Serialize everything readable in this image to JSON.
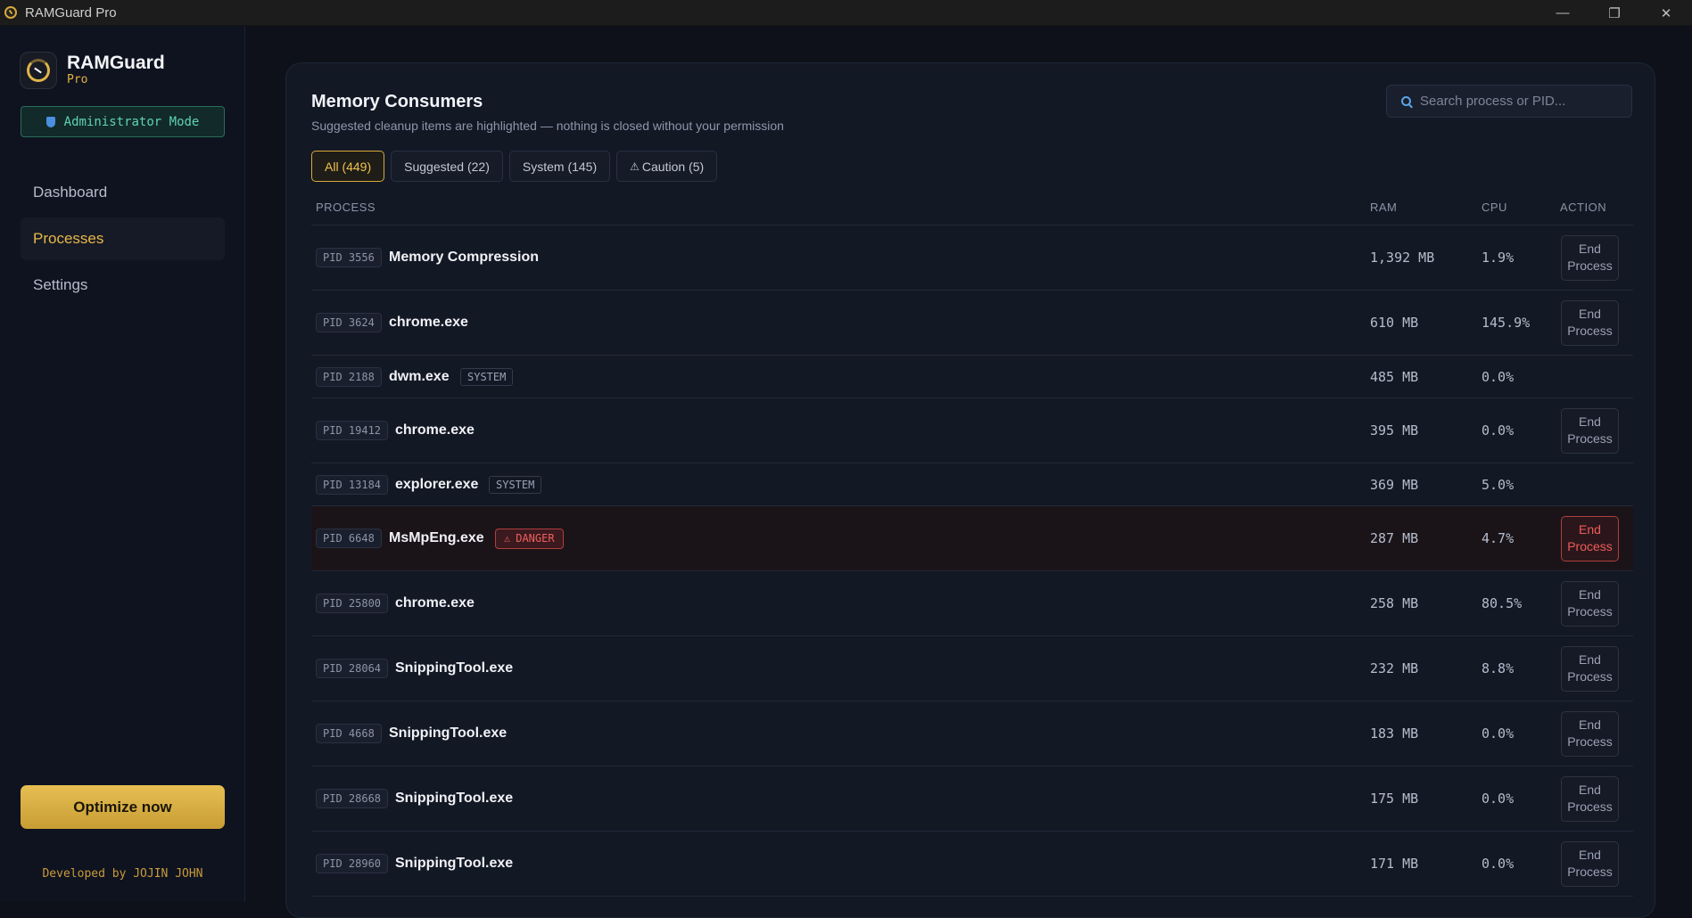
{
  "window": {
    "title": "RAMGuard Pro",
    "controls": {
      "minimize": "—",
      "maximize": "❐",
      "close": "✕"
    }
  },
  "sidebar": {
    "brand_name": "RAMGuard",
    "brand_sub": "Pro",
    "admin_badge": "Administrator Mode",
    "nav": [
      {
        "label": "Dashboard",
        "active": false
      },
      {
        "label": "Processes",
        "active": true
      },
      {
        "label": "Settings",
        "active": false
      }
    ],
    "optimize_label": "Optimize now",
    "credit": "Developed by JOJIN JOHN"
  },
  "main": {
    "title": "Memory Consumers",
    "subtitle": "Suggested cleanup items are highlighted — nothing is closed without your permission",
    "search_placeholder": "Search process or PID...",
    "filters": [
      {
        "label": "All (449)",
        "active": true
      },
      {
        "label": "Suggested (22)",
        "active": false
      },
      {
        "label": "System (145)",
        "active": false
      },
      {
        "label": "Caution (5)",
        "active": false,
        "icon": "⚠"
      }
    ],
    "columns": {
      "process": "PROCESS",
      "ram": "RAM",
      "cpu": "CPU",
      "action": "ACTION"
    },
    "end_label_line1": "End",
    "end_label_line2": "Process",
    "tag_system": "SYSTEM",
    "tag_danger": "DANGER",
    "rows": [
      {
        "pid": "PID 3556",
        "name": "Memory Compression",
        "ram": "1,392 MB",
        "cpu": "1.9%",
        "tag": "",
        "action": true
      },
      {
        "pid": "PID 3624",
        "name": "chrome.exe",
        "ram": "610 MB",
        "cpu": "145.9%",
        "tag": "",
        "action": true
      },
      {
        "pid": "PID 2188",
        "name": "dwm.exe",
        "ram": "485 MB",
        "cpu": "0.0%",
        "tag": "SYSTEM",
        "action": false
      },
      {
        "pid": "PID 19412",
        "name": "chrome.exe",
        "ram": "395 MB",
        "cpu": "0.0%",
        "tag": "",
        "action": true
      },
      {
        "pid": "PID 13184",
        "name": "explorer.exe",
        "ram": "369 MB",
        "cpu": "5.0%",
        "tag": "SYSTEM",
        "action": false
      },
      {
        "pid": "PID 6648",
        "name": "MsMpEng.exe",
        "ram": "287 MB",
        "cpu": "4.7%",
        "tag": "DANGER",
        "action": true
      },
      {
        "pid": "PID 25800",
        "name": "chrome.exe",
        "ram": "258 MB",
        "cpu": "80.5%",
        "tag": "",
        "action": true
      },
      {
        "pid": "PID 28064",
        "name": "SnippingTool.exe",
        "ram": "232 MB",
        "cpu": "8.8%",
        "tag": "",
        "action": true
      },
      {
        "pid": "PID 4668",
        "name": "SnippingTool.exe",
        "ram": "183 MB",
        "cpu": "0.0%",
        "tag": "",
        "action": true
      },
      {
        "pid": "PID 28668",
        "name": "SnippingTool.exe",
        "ram": "175 MB",
        "cpu": "0.0%",
        "tag": "",
        "action": true
      },
      {
        "pid": "PID 28960",
        "name": "SnippingTool.exe",
        "ram": "171 MB",
        "cpu": "0.0%",
        "tag": "",
        "action": true
      }
    ]
  },
  "colors": {
    "accent": "#e2b341",
    "danger": "#f05f5f",
    "admin": "#5fd3b3",
    "background": "#0e1119"
  }
}
